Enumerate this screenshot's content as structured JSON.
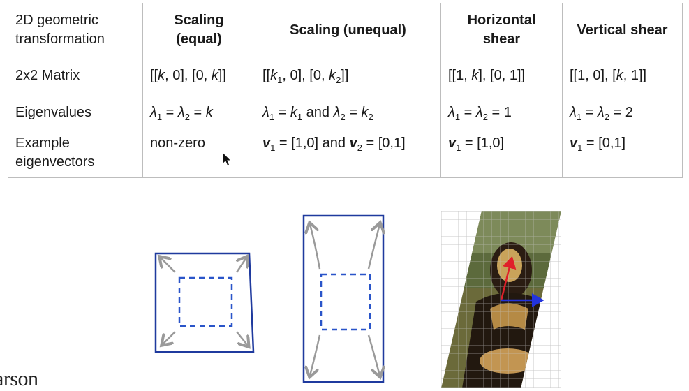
{
  "table": {
    "corner": "2D geometric transformation",
    "columns": [
      "Scaling (equal)",
      "Scaling (unequal)",
      "Horizontal shear",
      "Vertical shear"
    ],
    "row_labels": {
      "matrix": "2x2 Matrix",
      "eigenvalues": "Eigenvalues",
      "eigenvectors": "Example eigenvectors"
    },
    "matrix": {
      "equal_pre": "[[",
      "equal_k1": "k",
      "equal_mid": ", 0], [0, ",
      "equal_k2": "k",
      "equal_post": "]]",
      "unequal_pre": "[[",
      "unequal_k": "k",
      "unequal_sub1": "1",
      "unequal_mid": ", 0], [0, ",
      "unequal_sub2": "2",
      "unequal_post": "]]",
      "hshear_pre": "[[1, ",
      "hshear_k": "k",
      "hshear_post": "], [0, 1]]",
      "vshear_pre": "[[1, 0], [",
      "vshear_k": "k",
      "vshear_post": ", 1]]"
    },
    "eigenvalues": {
      "lambda": "λ",
      "sub1": "1",
      "sub2": "2",
      "equal_eq": " = ",
      "equal_val": "k",
      "unequal_and": " and ",
      "k": "k",
      "hshear_val": " = 1",
      "vshear_val": " = 2"
    },
    "eigenvectors": {
      "equal": "non-zero",
      "v": "v",
      "sub1": "1",
      "sub2": "2",
      "unequal_v1": " = [1,0] and ",
      "unequal_v2": " = [0,1]",
      "hshear": " = [1,0]",
      "vshear": " = [0,1]"
    }
  },
  "brand": "arson",
  "colors": {
    "frame": "#1f3a9e",
    "dashed": "#2a55c9",
    "arrow_gray": "#9a9a9a",
    "red_vector": "#e0202a",
    "blue_vector": "#2233dd"
  },
  "icons": [
    "mouse-cursor-icon"
  ]
}
